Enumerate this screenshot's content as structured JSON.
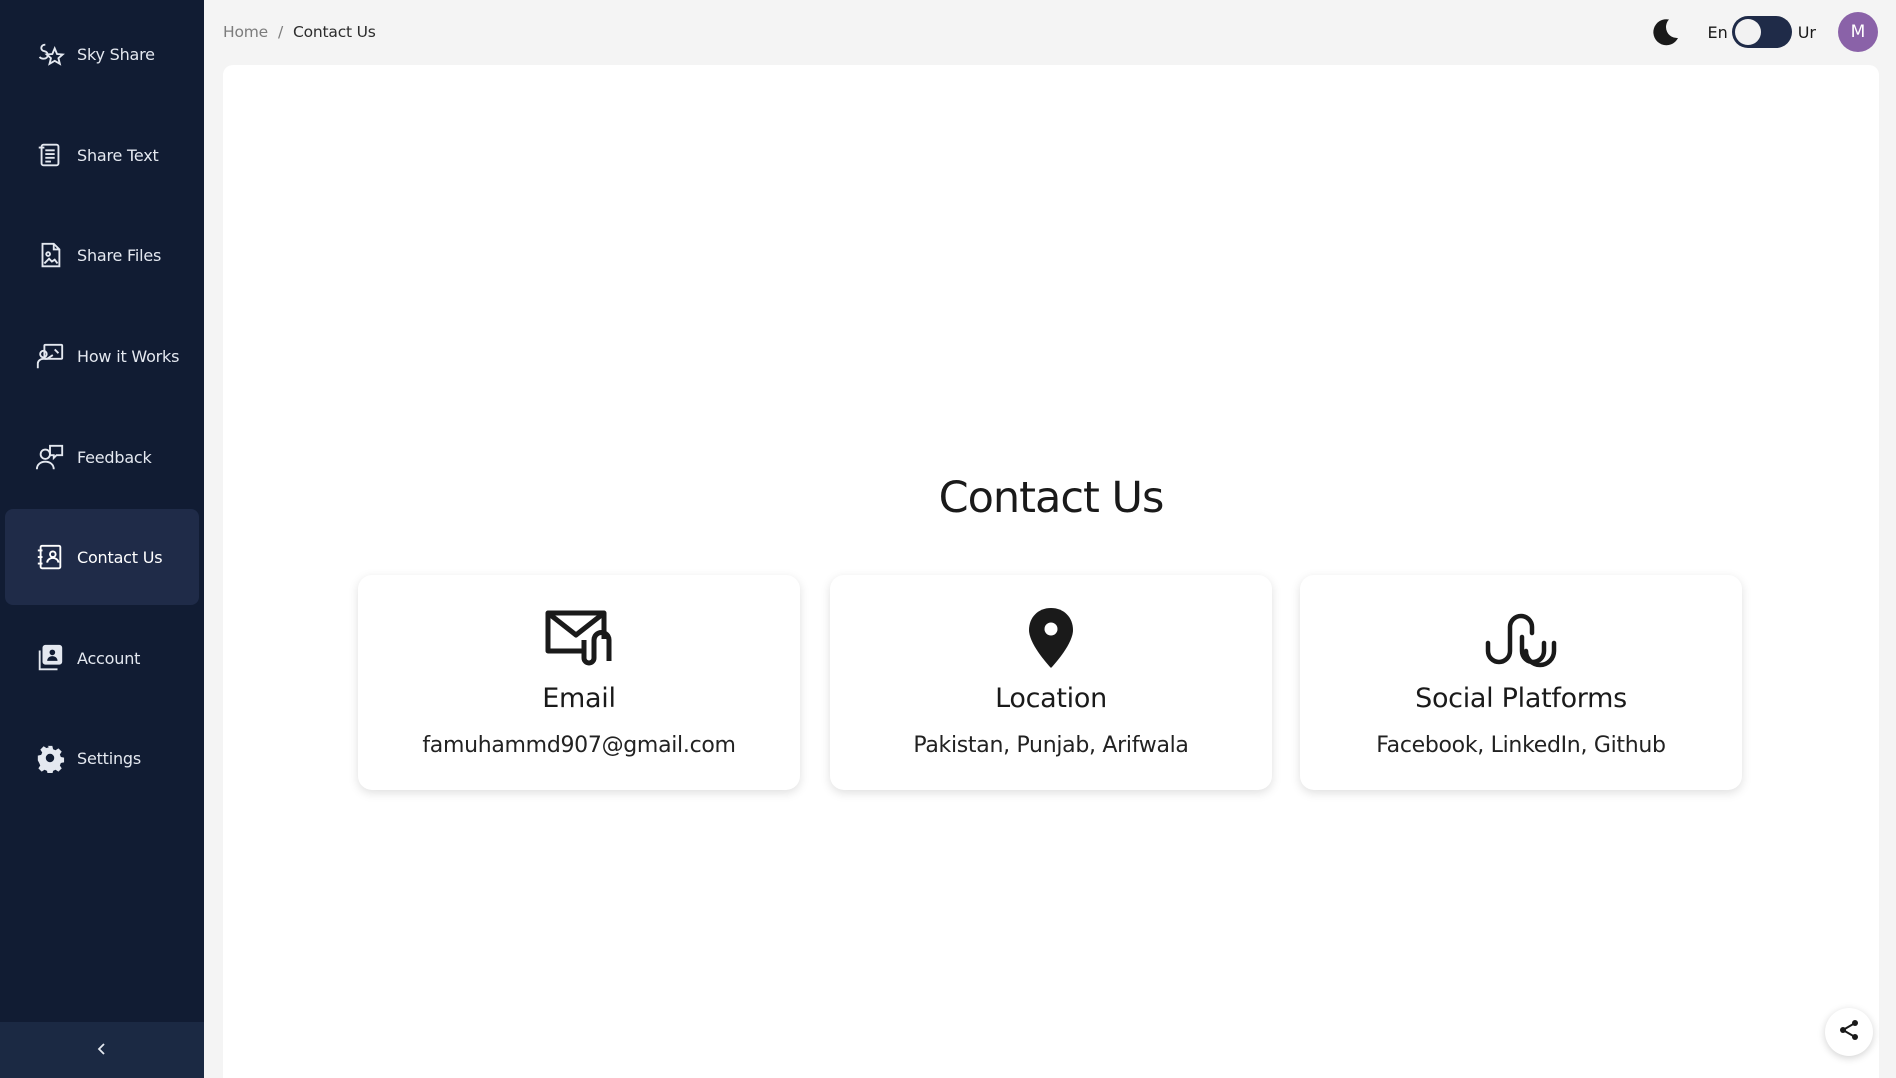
{
  "sidebar": {
    "items": [
      {
        "label": "Sky Share",
        "icon": "star-logo-icon"
      },
      {
        "label": "Share Text",
        "icon": "scroll-text-icon"
      },
      {
        "label": "Share Files",
        "icon": "image-file-icon"
      },
      {
        "label": "How it Works",
        "icon": "presentation-icon"
      },
      {
        "label": "Feedback",
        "icon": "user-message-icon"
      },
      {
        "label": "Contact Us",
        "icon": "contact-book-icon",
        "active": true
      },
      {
        "label": "Account",
        "icon": "account-card-icon"
      },
      {
        "label": "Settings",
        "icon": "gear-icon"
      }
    ],
    "collapse_icon": "chevron-left-icon"
  },
  "breadcrumb": {
    "home": "Home",
    "separator": "/",
    "current": "Contact Us"
  },
  "topbar": {
    "theme_icon": "moon-icon",
    "lang_left": "En",
    "lang_right": "Ur",
    "avatar_initial": "M",
    "avatar_color": "#8a62a8"
  },
  "main": {
    "title": "Contact Us",
    "cards": [
      {
        "title": "Email",
        "value": "famuhammd907@gmail.com",
        "icon": "email-attachment-icon"
      },
      {
        "title": "Location",
        "value": "Pakistan,  Punjab, Arifwala",
        "icon": "map-pin-icon"
      },
      {
        "title": "Social Platforms",
        "value": "Facebook,  LinkedIn, Github",
        "icon": "stumbleupon-icon"
      }
    ]
  },
  "colors": {
    "sidebar_bg": "#111c33",
    "active_bg": "#1f2b48",
    "panel_bg": "#ffffff",
    "page_bg": "#f4f4f4"
  },
  "share_fab_icon": "share-icon"
}
